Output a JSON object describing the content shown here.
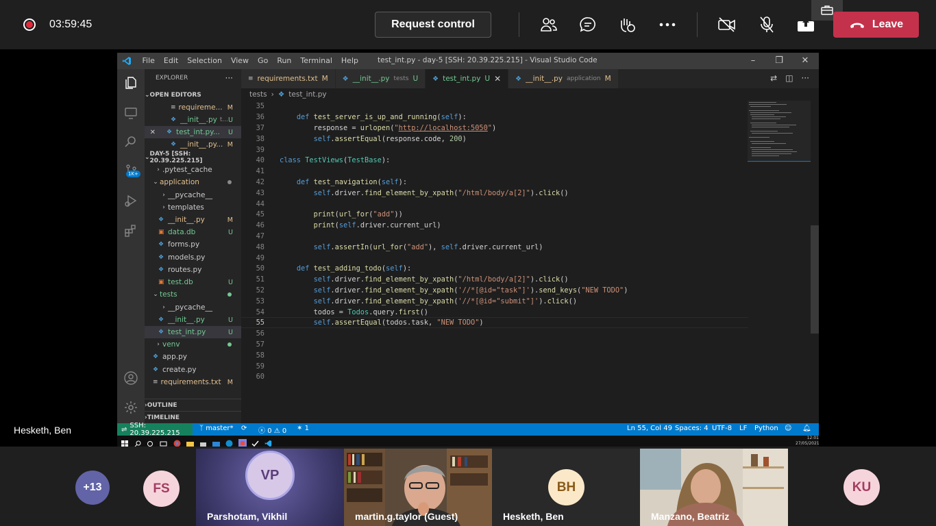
{
  "meeting": {
    "timer": "03:59:45",
    "request_control_label": "Request control",
    "leave_label": "Leave",
    "presenter_name": "Hesketh, Ben"
  },
  "vscode": {
    "menu": [
      "File",
      "Edit",
      "Selection",
      "View",
      "Go",
      "Run",
      "Terminal",
      "Help"
    ],
    "window_title": "test_int.py - day-5 [SSH: 20.39.225.215] - Visual Studio Code",
    "explorer_label": "EXPLORER",
    "open_editors_label": "OPEN EDITORS",
    "open_editors": [
      {
        "name": "requireme...",
        "badge": "M"
      },
      {
        "name": "__init__.py",
        "sub": "t...",
        "badge": "U"
      },
      {
        "name": "test_int.py...",
        "badge": "U"
      },
      {
        "name": "__init__.py...",
        "badge": "M"
      }
    ],
    "workspace_label": "DAY-5 [SSH: 20.39.225.215]",
    "tree": [
      {
        "name": ".pytest_cache"
      },
      {
        "name": "application"
      },
      {
        "name": "__pycache__"
      },
      {
        "name": "templates"
      },
      {
        "name": "__init__.py",
        "badge": "M"
      },
      {
        "name": "data.db",
        "badge": "U"
      },
      {
        "name": "forms.py"
      },
      {
        "name": "models.py"
      },
      {
        "name": "routes.py"
      },
      {
        "name": "test.db",
        "badge": "U"
      },
      {
        "name": "tests"
      },
      {
        "name": "__pycache__"
      },
      {
        "name": "__init__.py",
        "badge": "U"
      },
      {
        "name": "test_int.py",
        "badge": "U"
      },
      {
        "name": "venv"
      },
      {
        "name": "app.py"
      },
      {
        "name": "create.py"
      },
      {
        "name": "requirements.txt",
        "badge": "M"
      }
    ],
    "outline_label": "OUTLINE",
    "timeline_label": "TIMELINE",
    "tabs": [
      {
        "name": "requirements.txt",
        "sub": "",
        "badge": "M"
      },
      {
        "name": "__init__.py",
        "sub": "tests",
        "badge": "U"
      },
      {
        "name": "test_int.py",
        "sub": "",
        "badge": "U"
      },
      {
        "name": "__init__.py",
        "sub": "application",
        "badge": "M"
      }
    ],
    "breadcrumb": [
      "tests",
      "test_int.py"
    ],
    "line_numbers": [
      "35",
      "36",
      "37",
      "38",
      "39",
      "40",
      "41",
      "42",
      "43",
      "44",
      "45",
      "46",
      "47",
      "48",
      "49",
      "50",
      "51",
      "52",
      "53",
      "54",
      "55",
      "56",
      "57",
      "58",
      "59",
      "60"
    ],
    "status": {
      "remote": "SSH: 20.39.225.215",
      "branch": "master*",
      "errors": "0",
      "warnings": "0",
      "ports": "1",
      "position": "Ln 55, Col 49",
      "spaces": "Spaces: 4",
      "encoding": "UTF-8",
      "eol": "LF",
      "language": "Python"
    },
    "activity_badge": "1K+",
    "clock_time": "12:01",
    "clock_date": "27/05/2021"
  },
  "participants": {
    "overflow": "+13",
    "people": [
      {
        "initials": "FS"
      },
      {
        "initials": "VP",
        "name": "Parshotam, Vikhil"
      },
      {
        "name": "martin.g.taylor (Guest)"
      },
      {
        "initials": "BH",
        "name": "Hesketh, Ben"
      },
      {
        "name": "Manzano, Beatriz"
      },
      {
        "initials": "KU"
      }
    ]
  },
  "colors": {
    "accent_blue": "#007acc",
    "leave_red": "#c4314b",
    "remote_green": "#16825d"
  }
}
